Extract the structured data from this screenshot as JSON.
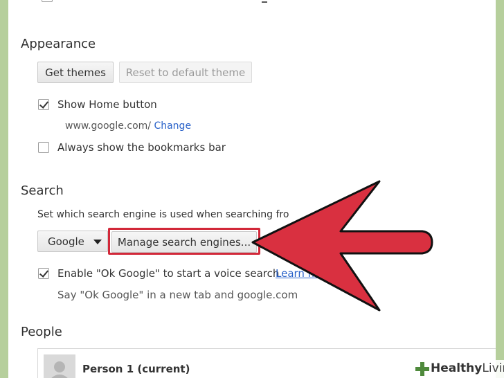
{
  "appearance": {
    "title": "Appearance",
    "get_themes": "Get themes",
    "reset_theme": "Reset to default theme",
    "show_home": {
      "label": "Show Home button",
      "checked": true
    },
    "home_url": "www.google.com/",
    "home_change": "Change",
    "bookmarks_bar": {
      "label": "Always show the bookmarks bar",
      "checked": false
    }
  },
  "search": {
    "title": "Search",
    "description": "Set which search engine is used when searching fro",
    "engine": "Google",
    "manage": "Manage search engines...",
    "ok_google": {
      "label": "Enable \"Ok Google\" to start a voice search",
      "checked": true
    },
    "learn_more": "Learn mo",
    "ok_google_hint": "Say \"Ok Google\" in a new tab and google.com"
  },
  "people": {
    "title": "People",
    "person": "Person 1 (current)"
  },
  "colors": {
    "arrow_fill": "#d93040",
    "arrow_stroke": "#111111",
    "highlight": "#d22839",
    "link": "#2a62c9"
  },
  "watermark": {
    "part_a": "Healthy",
    "part_b": "Living"
  }
}
